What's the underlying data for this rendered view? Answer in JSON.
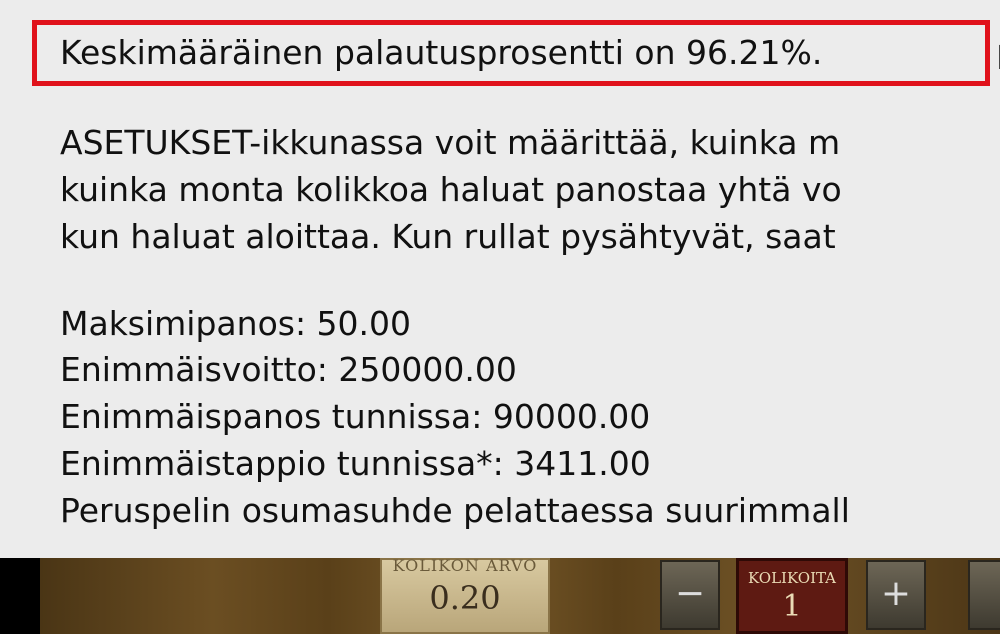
{
  "rules": {
    "rtp_line": "Keskimääräinen palautusprosentti on 96.21%.",
    "rtp_cont": "I",
    "settings_lines": [
      "ASETUKSET-ikkunassa voit määrittää, kuinka m",
      "kuinka monta kolikkoa haluat panostaa yhtä vo",
      "kun haluat aloittaa. Kun rullat pysähtyvät, saat"
    ],
    "limits": [
      "Maksimipanos: 50.00",
      "Enimmäisvoitto: 250000.00",
      "Enimmäispanos tunnissa: 90000.00",
      "Enimmäistappio tunnissa*: 3411.00",
      "Peruspelin osumasuhde pelattaessa suurimmall"
    ]
  },
  "game": {
    "coin_value_label": "KOLIKON ARVO",
    "coin_value": "0.20",
    "coins_label": "KOLIKOITA",
    "coins": "1",
    "minus": "−",
    "plus": "+"
  },
  "colors": {
    "highlight": "#e0121b",
    "panel_bg": "#ececec"
  }
}
